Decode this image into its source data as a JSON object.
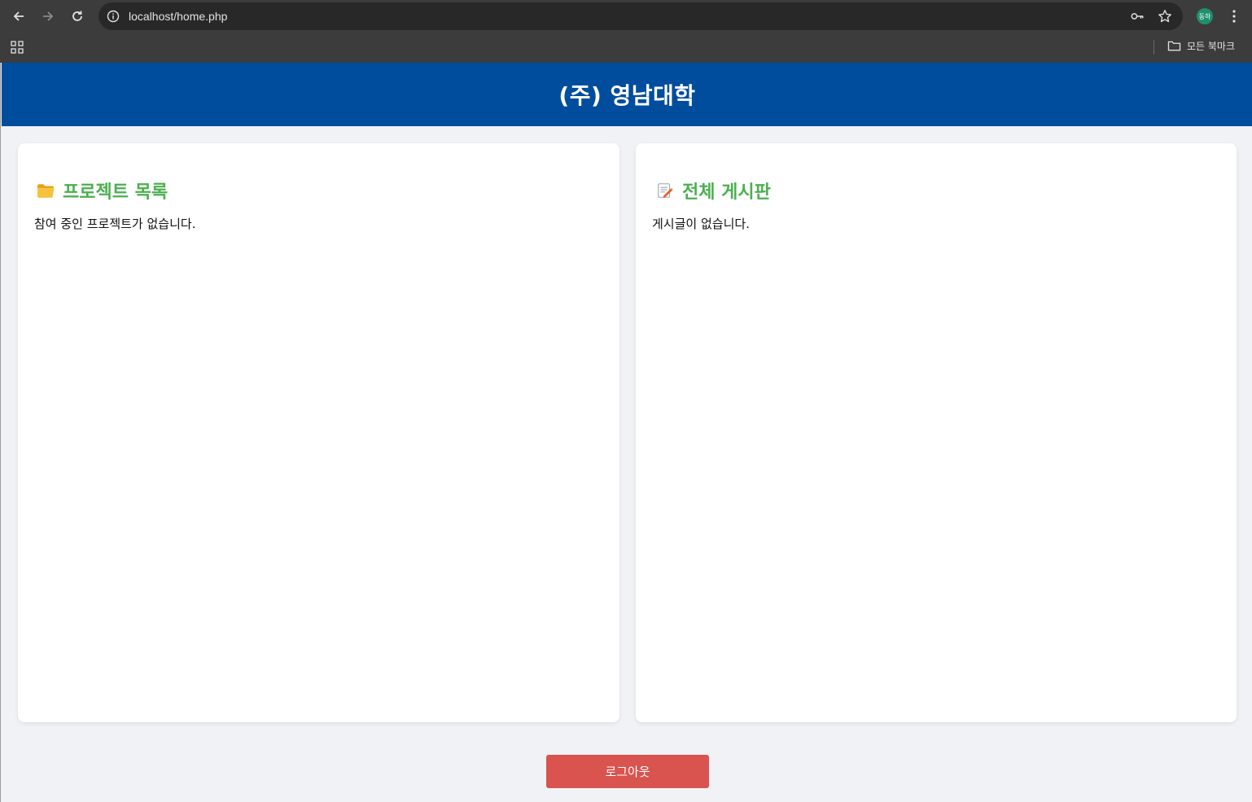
{
  "browser": {
    "url": "localhost/home.php",
    "profile_initials": "동하",
    "bookmarks_all_label": "모든 북마크"
  },
  "header": {
    "title": "(주) 영남대학",
    "background_color": "#004d9d"
  },
  "projects_panel": {
    "heading": "프로젝트 목록",
    "icon": "folder-icon",
    "empty_message": "참여 중인 프로젝트가 없습니다."
  },
  "board_panel": {
    "heading": "전체 게시판",
    "icon": "memo-icon",
    "empty_message": "게시글이 없습니다."
  },
  "logout": {
    "label": "로그아웃",
    "color": "#d9534f"
  },
  "colors": {
    "heading_accent": "#4caf50",
    "page_background": "#f0f2f5"
  }
}
